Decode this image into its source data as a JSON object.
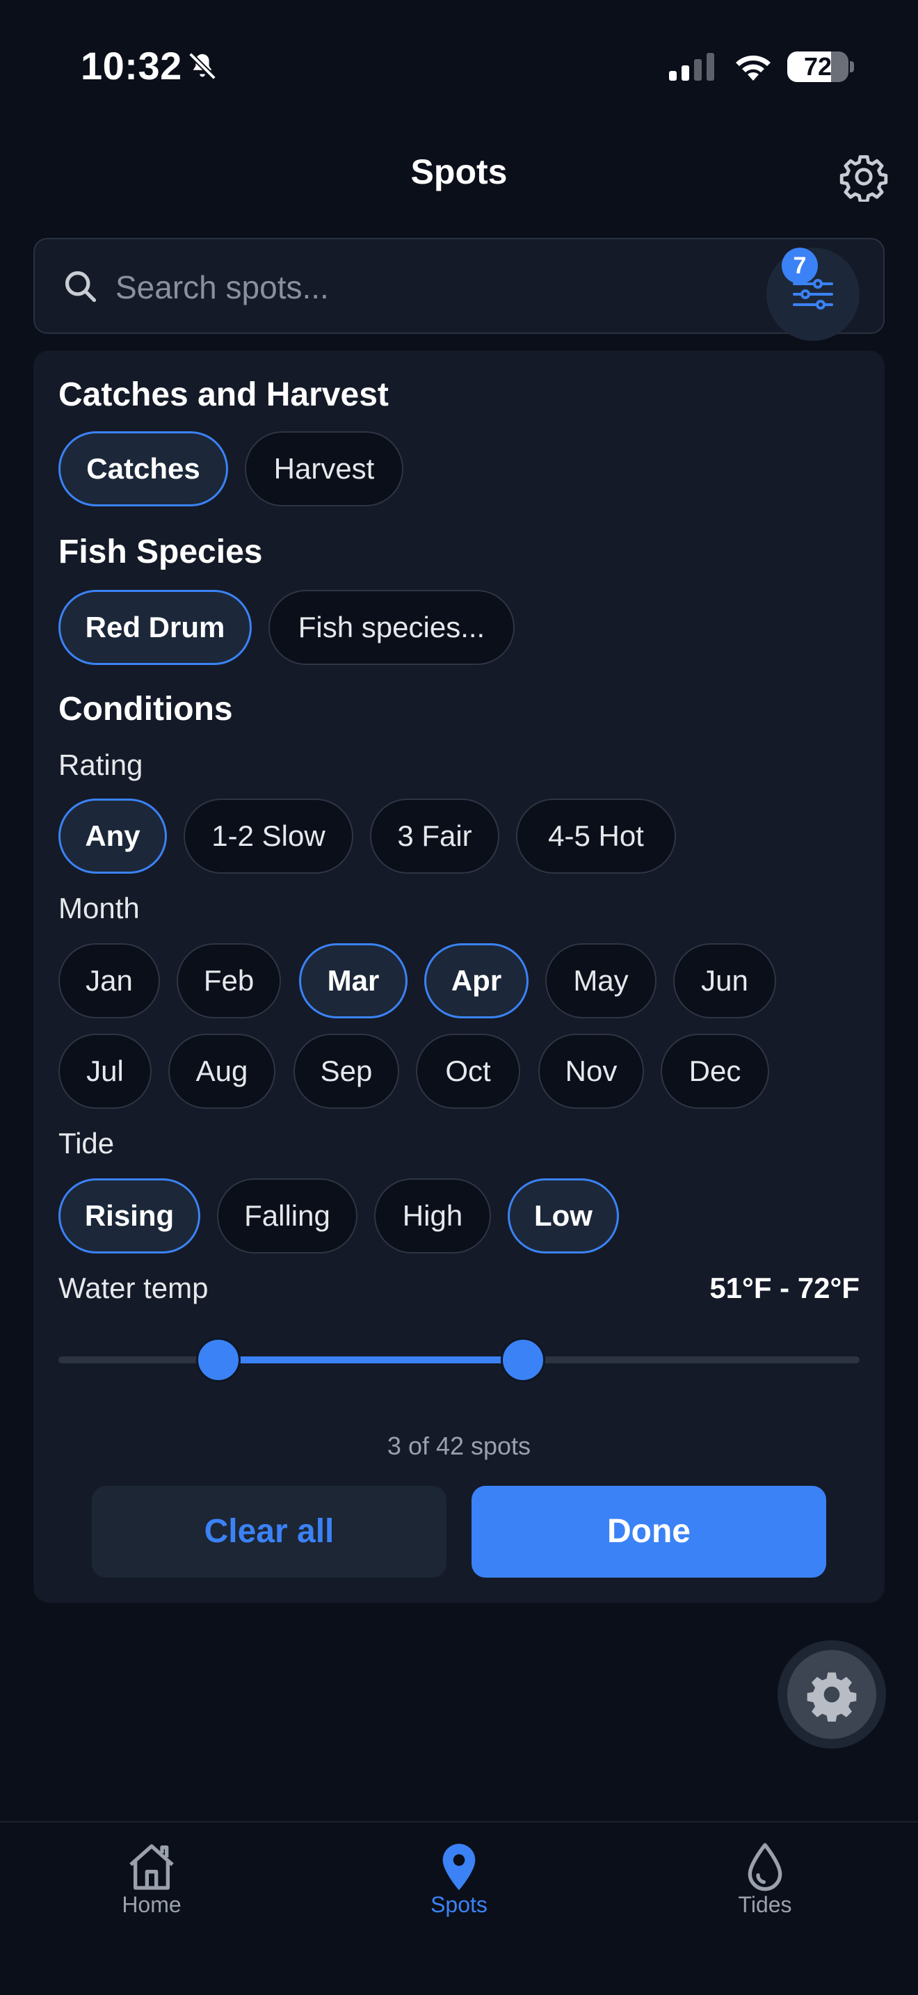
{
  "status_bar": {
    "time": "10:32",
    "battery": "72",
    "battery_level": 0.72
  },
  "header": {
    "title": "Spots"
  },
  "search": {
    "placeholder": "Search spots...",
    "value": "",
    "filter_count": "7"
  },
  "filters": {
    "catches_harvest": {
      "title": "Catches and Harvest",
      "options": [
        {
          "label": "Catches",
          "selected": true
        },
        {
          "label": "Harvest",
          "selected": false
        }
      ]
    },
    "fish_species": {
      "title": "Fish Species",
      "options": [
        {
          "label": "Red Drum",
          "selected": true
        },
        {
          "label": "Fish species...",
          "selected": false
        }
      ]
    },
    "conditions": {
      "title": "Conditions",
      "rating": {
        "label": "Rating",
        "options": [
          {
            "label": "Any",
            "selected": true
          },
          {
            "label": "1-2 Slow",
            "selected": false
          },
          {
            "label": "3 Fair",
            "selected": false
          },
          {
            "label": "4-5 Hot",
            "selected": false
          }
        ]
      },
      "month": {
        "label": "Month",
        "options": [
          {
            "label": "Jan",
            "selected": false
          },
          {
            "label": "Feb",
            "selected": false
          },
          {
            "label": "Mar",
            "selected": true
          },
          {
            "label": "Apr",
            "selected": true
          },
          {
            "label": "May",
            "selected": false
          },
          {
            "label": "Jun",
            "selected": false
          },
          {
            "label": "Jul",
            "selected": false
          },
          {
            "label": "Aug",
            "selected": false
          },
          {
            "label": "Sep",
            "selected": false
          },
          {
            "label": "Oct",
            "selected": false
          },
          {
            "label": "Nov",
            "selected": false
          },
          {
            "label": "Dec",
            "selected": false
          }
        ]
      },
      "tide": {
        "label": "Tide",
        "options": [
          {
            "label": "Rising",
            "selected": true
          },
          {
            "label": "Falling",
            "selected": false
          },
          {
            "label": "High",
            "selected": false
          },
          {
            "label": "Low",
            "selected": true
          }
        ]
      },
      "water_temp": {
        "label": "Water temp",
        "range_text": "51°F - 72°F",
        "low_fraction": 0.2,
        "high_fraction": 0.58
      }
    }
  },
  "results": {
    "text": "3 of 42 spots"
  },
  "actions": {
    "clear_label": "Clear all",
    "done_label": "Done"
  },
  "nav": {
    "items": [
      {
        "label": "Home",
        "icon": "home-icon",
        "active": false
      },
      {
        "label": "Spots",
        "icon": "map-pin-icon",
        "active": true
      },
      {
        "label": "Tides",
        "icon": "water-drop-icon",
        "active": false
      }
    ]
  },
  "colors": {
    "accent": "#3b82f6",
    "background": "#0b0f1a",
    "panel": "#141a27"
  }
}
